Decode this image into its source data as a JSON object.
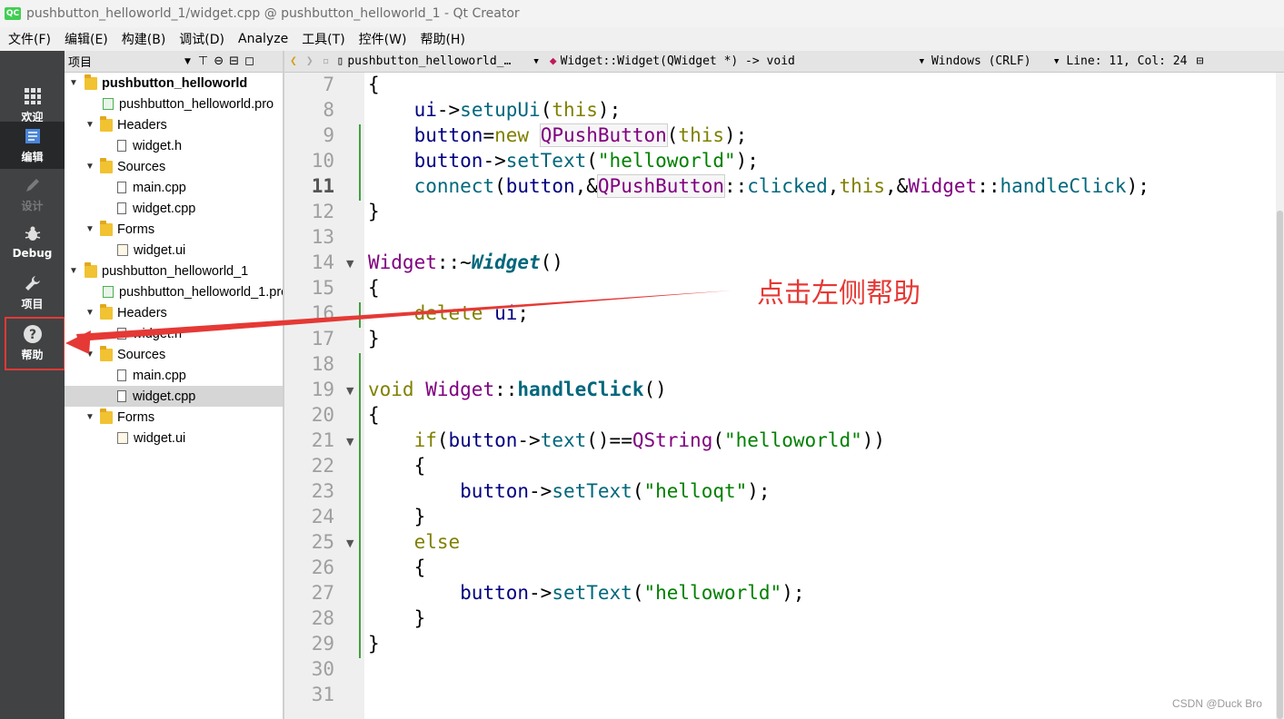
{
  "window": {
    "app_icon": "QC",
    "title": "pushbutton_helloworld_1/widget.cpp @ pushbutton_helloworld_1 - Qt Creator"
  },
  "menu": [
    "文件(F)",
    "编辑(E)",
    "构建(B)",
    "调试(D)",
    "Analyze",
    "工具(T)",
    "控件(W)",
    "帮助(H)"
  ],
  "modes": [
    {
      "label": "欢迎",
      "icon": "grid-icon"
    },
    {
      "label": "编辑",
      "icon": "document-icon"
    },
    {
      "label": "设计",
      "icon": "pencil-icon"
    },
    {
      "label": "Debug",
      "icon": "bug-icon"
    },
    {
      "label": "项目",
      "icon": "wrench-icon"
    },
    {
      "label": "帮助",
      "icon": "question-icon"
    }
  ],
  "project_panel": {
    "title": "项目",
    "tree": [
      {
        "label": "pushbutton_helloworld",
        "kind": "project",
        "bold": true
      },
      {
        "label": "pushbutton_helloworld.pro",
        "kind": "pro"
      },
      {
        "label": "Headers",
        "kind": "folder"
      },
      {
        "label": "widget.h",
        "kind": "file"
      },
      {
        "label": "Sources",
        "kind": "folder"
      },
      {
        "label": "main.cpp",
        "kind": "file"
      },
      {
        "label": "widget.cpp",
        "kind": "file"
      },
      {
        "label": "Forms",
        "kind": "folder"
      },
      {
        "label": "widget.ui",
        "kind": "ui"
      },
      {
        "label": "pushbutton_helloworld_1",
        "kind": "project"
      },
      {
        "label": "pushbutton_helloworld_1.pro",
        "kind": "pro"
      },
      {
        "label": "Headers",
        "kind": "folder"
      },
      {
        "label": "widget.h",
        "kind": "file"
      },
      {
        "label": "Sources",
        "kind": "folder"
      },
      {
        "label": "main.cpp",
        "kind": "file"
      },
      {
        "label": "widget.cpp",
        "kind": "file",
        "selected": true
      },
      {
        "label": "Forms",
        "kind": "folder"
      },
      {
        "label": "widget.ui",
        "kind": "ui"
      }
    ]
  },
  "editor_toolbar": {
    "file_name": "pushbutton_helloworld_…",
    "symbol": "Widget::Widget(QWidget *) -> void",
    "line_ending": "Windows (CRLF)",
    "cursor_position": "Line: 11, Col: 24"
  },
  "editor": {
    "line_numbers": [
      "7",
      "8",
      "9",
      "10",
      "11",
      "12",
      "13",
      "14",
      "15",
      "16",
      "17",
      "18",
      "19",
      "20",
      "21",
      "22",
      "23",
      "24",
      "25",
      "26",
      "27",
      "28",
      "29",
      "30",
      "31"
    ],
    "current_line": "11",
    "code": [
      "{",
      "    ui->setupUi(this);",
      "    button=new QPushButton(this);",
      "    button->setText(\"helloworld\");",
      "    connect(button,&QPushButton::clicked,this,&Widget::handleClick);",
      "}",
      "",
      "Widget::~Widget()",
      "{",
      "    delete ui;",
      "}",
      "",
      "void Widget::handleClick()",
      "{",
      "    if(button->text()==QString(\"helloworld\"))",
      "    {",
      "        button->setText(\"helloqt\");",
      "    }",
      "    else",
      "    {",
      "        button->setText(\"helloworld\");",
      "    }",
      "}",
      "",
      ""
    ]
  },
  "annotation": {
    "text": "点击左侧帮助",
    "color": "#e53935"
  },
  "watermark": "CSDN @Duck Bro"
}
